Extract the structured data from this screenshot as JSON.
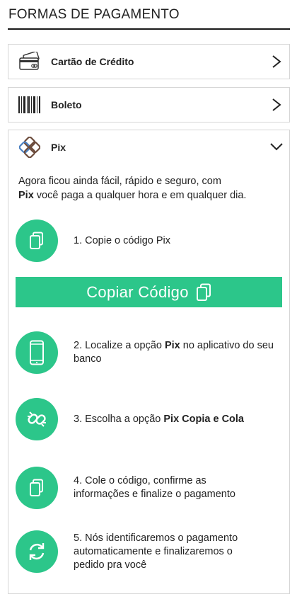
{
  "page": {
    "title": "FORMAS DE PAGAMENTO"
  },
  "methods": {
    "credit": {
      "label": "Cartão de Crédito",
      "icon": "credit-card-icon"
    },
    "boleto": {
      "label": "Boleto",
      "icon": "barcode-icon"
    },
    "pix": {
      "label": "Pix",
      "icon": "pix-logo-icon"
    }
  },
  "pix": {
    "intro_line1": "Agora ficou ainda fácil, rápido e seguro, com",
    "intro_bold": "Pix",
    "intro_line2": " você paga a qualquer  hora e em qualquer dia.",
    "copy_button": "Copiar Código",
    "steps": [
      {
        "text": "1. Copie o código Pix",
        "icon": "copy-icon"
      },
      {
        "pre": "2. Localize a opção ",
        "bold": "Pix",
        "post": " no aplicativo do seu banco",
        "icon": "smartphone-icon"
      },
      {
        "pre": "3. Escolha a opção ",
        "bold": "Pix Copia e Cola",
        "post": "",
        "icon": "link-icon"
      },
      {
        "text": "4. Cole o código, confirme as informações e finalize o pagamento",
        "icon": "copy-icon"
      },
      {
        "text": "5. Nós identificaremos o pagamento automaticamente e finalizaremos o pedido pra você",
        "icon": "refresh-icon"
      }
    ]
  },
  "colors": {
    "accent": "#2cc68a",
    "pix_logo_brown": "#6b4a3a",
    "pix_logo_blue": "#4a7fc0"
  }
}
